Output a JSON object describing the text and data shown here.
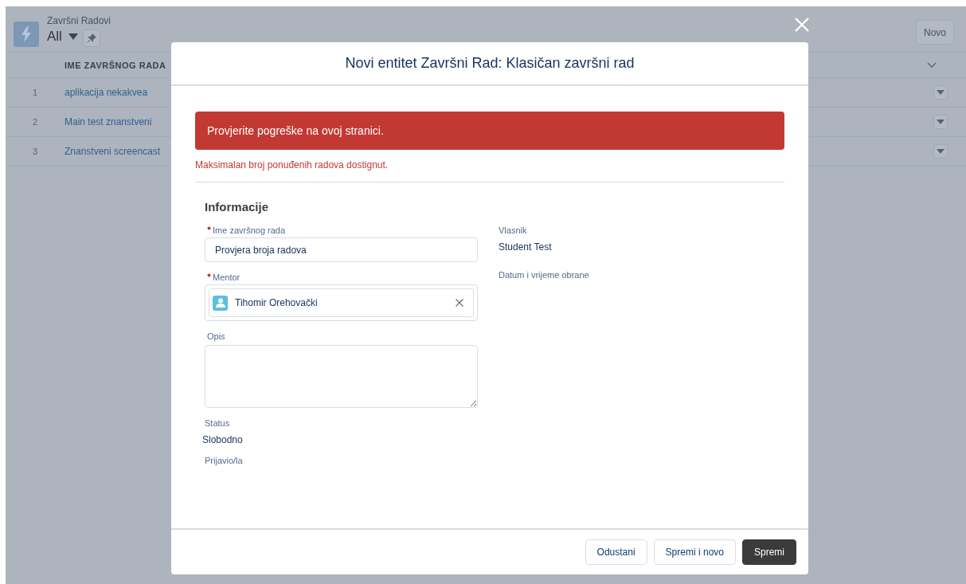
{
  "list_view": {
    "object_label": "Završni Radovi",
    "view_name": "All",
    "new_button": "Novo",
    "columns": [
      "IME ZAVRŠNOG RADA"
    ],
    "rows": [
      {
        "number": "1",
        "name": "aplikacija nekakvea"
      },
      {
        "number": "2",
        "name": "Main test znanstveni"
      },
      {
        "number": "3",
        "name": "Znanstveni screencast"
      }
    ]
  },
  "modal": {
    "title": "Novi entitet Završni Rad: Klasičan završni rad",
    "error_banner": "Provjerite pogreške na ovoj stranici.",
    "error_message": "Maksimalan broj ponuđenih radova dostignut.",
    "section_title": "Informacije",
    "left_fields": [
      {
        "kind": "text",
        "label": "Ime završnog rada",
        "required": true,
        "value": "Provjera broja radova"
      },
      {
        "kind": "lookup",
        "label": "Mentor",
        "required": true,
        "value": "Tihomir Orehovački"
      },
      {
        "kind": "textarea",
        "label": "Opis",
        "required": false
      },
      {
        "kind": "readonly",
        "label": "Status",
        "required": false,
        "value": "Slobodno"
      },
      {
        "kind": "readonly",
        "label": "Prijavio/la",
        "required": false
      }
    ],
    "right_fields": [
      {
        "label": "Vlasnik",
        "value": "Student Test"
      },
      {
        "label": "Datum i vrijeme obrane"
      }
    ],
    "buttons": [
      {
        "label": "Odustani",
        "kind": "neutral"
      },
      {
        "label": "Spremi i novo",
        "kind": "neutral"
      },
      {
        "label": "Spremi",
        "kind": "brand"
      }
    ]
  }
}
